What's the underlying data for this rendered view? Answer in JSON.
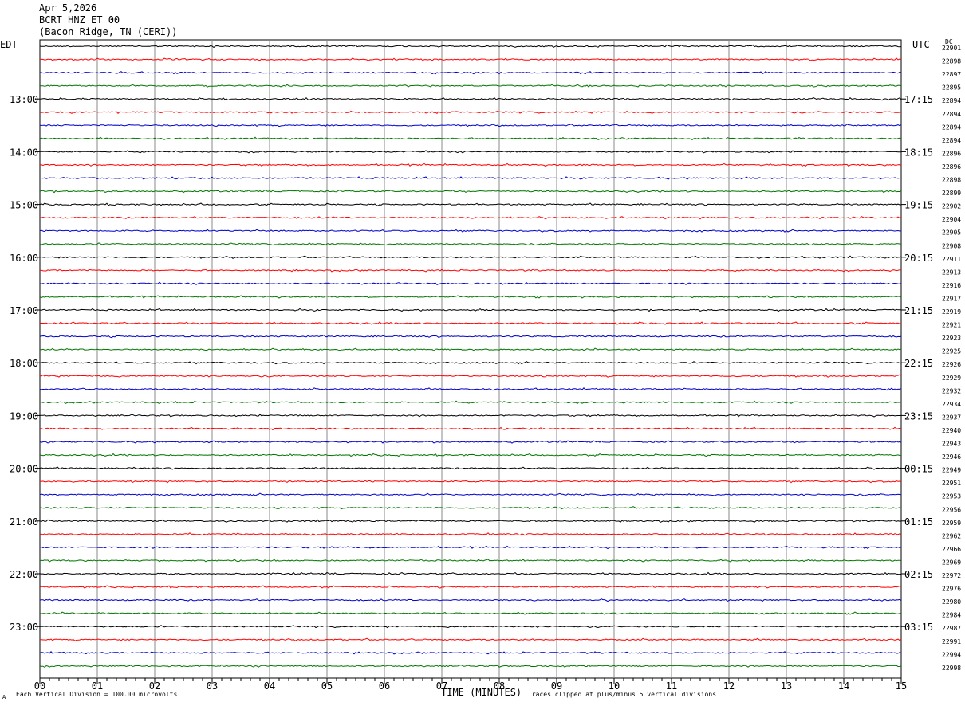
{
  "header": {
    "date": "Apr 5,2026",
    "station": "BCRT HNZ ET 00",
    "location": "(Bacon Ridge, TN (CERI))"
  },
  "left_axis_title": "EDT",
  "right_axis_title": "UTC",
  "dc_title": "DC",
  "footer": {
    "xlabel": "TIME (MINUTES)",
    "scale_note": "Each Vertical Division =  100.00 microvolts",
    "clip_note": "Traces clipped at plus/minus 5 vertical divisions",
    "corner_mark": "A"
  },
  "chart_data": {
    "type": "line",
    "title": "",
    "xlabel": "TIME (MINUTES)",
    "xlim": [
      0,
      15
    ],
    "x_ticks": [
      "00",
      "01",
      "02",
      "03",
      "04",
      "05",
      "06",
      "07",
      "08",
      "09",
      "10",
      "11",
      "12",
      "13",
      "14",
      "15"
    ],
    "trace_colors": [
      "#000000",
      "#ff0000",
      "#0000cc",
      "#007700"
    ],
    "traces_per_hour": 4,
    "left_hour_labels": [
      "13:00",
      "14:00",
      "15:00",
      "16:00",
      "17:00",
      "18:00",
      "19:00",
      "20:00",
      "21:00",
      "22:00",
      "23:00"
    ],
    "right_hour_labels": [
      "17:15",
      "18:15",
      "19:15",
      "20:15",
      "21:15",
      "22:15",
      "23:15",
      "00:15",
      "01:15",
      "02:15",
      "03:15"
    ],
    "dc_offsets": [
      22901,
      22898,
      22897,
      22895,
      22894,
      22894,
      22894,
      22894,
      22896,
      22896,
      22898,
      22899,
      22902,
      22904,
      22905,
      22908,
      22911,
      22913,
      22916,
      22917,
      22919,
      22921,
      22923,
      22925,
      22926,
      22929,
      22932,
      22934,
      22937,
      22940,
      22943,
      22946,
      22949,
      22951,
      22953,
      22956,
      22959,
      22962,
      22966,
      22969,
      22972,
      22976,
      22980,
      22984,
      22987,
      22991,
      22994,
      22998
    ],
    "vertical_division_microvolts": 100.0,
    "clip_divisions": 5
  }
}
